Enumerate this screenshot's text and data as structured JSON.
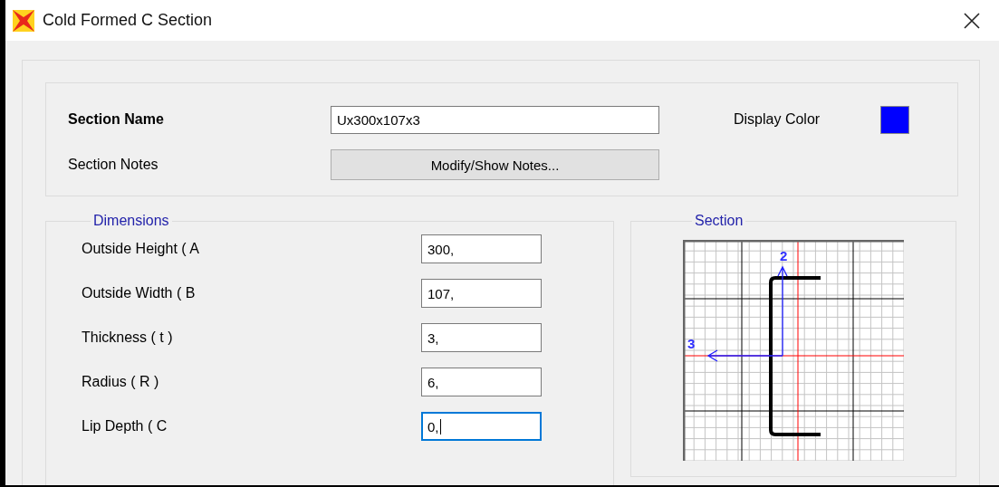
{
  "window": {
    "title": "Cold Formed C Section"
  },
  "section_name": {
    "label": "Section Name",
    "value": "Ux300x107x3"
  },
  "section_notes": {
    "label": "Section Notes",
    "button": "Modify/Show Notes..."
  },
  "display_color": {
    "label": "Display Color",
    "color": "#0000ff"
  },
  "dimensions": {
    "title": "Dimensions",
    "fields": [
      {
        "label": "Outside Height  ( A",
        "value": "300,",
        "focused": false
      },
      {
        "label": "Outside Width  ( B",
        "value": "107,",
        "focused": false
      },
      {
        "label": "Thickness  ( t )",
        "value": "3,",
        "focused": false
      },
      {
        "label": "Radius  ( R )",
        "value": "6,",
        "focused": false
      },
      {
        "label": "Lip Depth  ( C",
        "value": "0,",
        "focused": true
      }
    ]
  },
  "section": {
    "title": "Section",
    "axis_labels": [
      "2",
      "3"
    ]
  }
}
